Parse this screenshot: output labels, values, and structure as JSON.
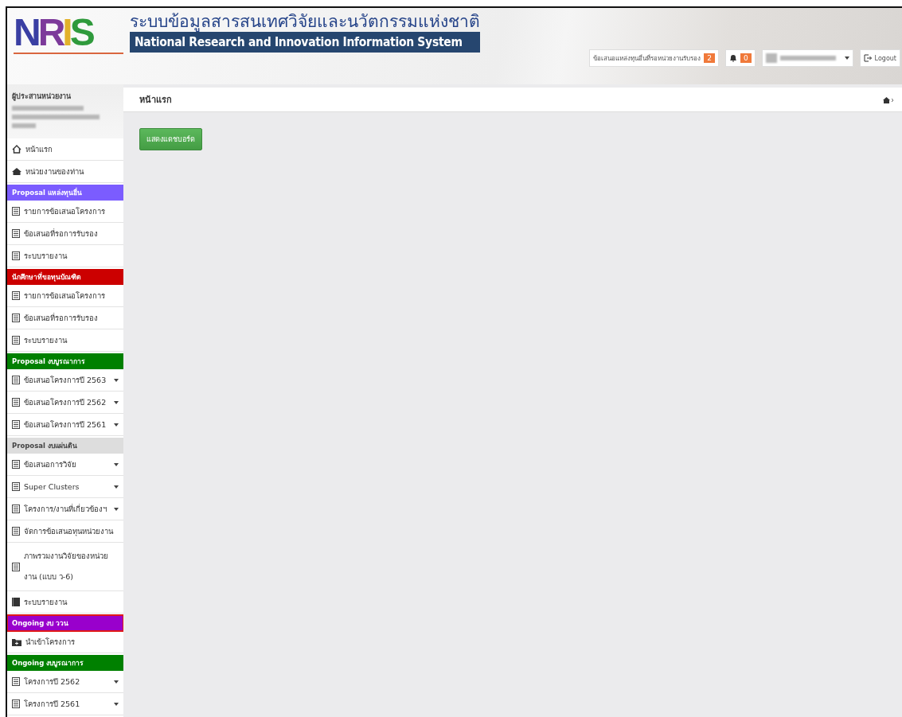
{
  "header": {
    "logo": "NRIS",
    "title_th": "ระบบข้อมูลสารสนเทศวิจัยและนวัตกรรมแห่งชาติ",
    "title_en": "National Research and Innovation Information System",
    "pending_button": {
      "label": "ข้อเสนอแหล่งทุนอื่นที่รอหน่วยงานรับรอง",
      "badge": "2"
    },
    "alerts_badge": "0",
    "logout": "Logout"
  },
  "sidebar": {
    "role": "ผู้ประสานหน่วยงาน",
    "items": [
      {
        "kind": "home",
        "label": "หน้าแรก",
        "expandable": false
      },
      {
        "kind": "unit",
        "label": "หน่วยงานของท่าน",
        "expandable": false
      },
      {
        "kind": "header",
        "label": "Proposal แหล่งทุนอื่น",
        "color": "#7b5cff",
        "highlighted": false
      },
      {
        "kind": "link",
        "label": "รายการข้อเสนอโครงการ",
        "expandable": false
      },
      {
        "kind": "link",
        "label": "ข้อเสนอที่รอการรับรอง",
        "expandable": false
      },
      {
        "kind": "link",
        "label": "ระบบรายงาน",
        "expandable": false
      },
      {
        "kind": "header",
        "label": "นักศึกษาที่ขอทุนบัณฑิต",
        "color": "#cc0000",
        "highlighted": false
      },
      {
        "kind": "link",
        "label": "รายการข้อเสนอโครงการ",
        "expandable": false
      },
      {
        "kind": "link",
        "label": "ข้อเสนอที่รอการรับรอง",
        "expandable": false
      },
      {
        "kind": "link",
        "label": "ระบบรายงาน",
        "expandable": false
      },
      {
        "kind": "header",
        "label": "Proposal งบบูรณาการ",
        "color": "#008000",
        "highlighted": false
      },
      {
        "kind": "link",
        "label": "ข้อเสนอโครงการปี 2563",
        "expandable": true
      },
      {
        "kind": "link",
        "label": "ข้อเสนอโครงการปี 2562",
        "expandable": true
      },
      {
        "kind": "link",
        "label": "ข้อเสนอโครงการปี 2561",
        "expandable": true
      },
      {
        "kind": "header",
        "label": "Proposal งบแผ่นดิน",
        "color": "#dddddd",
        "highlighted": false
      },
      {
        "kind": "link",
        "label": "ข้อเสนอการวิจัย",
        "expandable": true
      },
      {
        "kind": "link",
        "label": "Super Clusters",
        "expandable": true
      },
      {
        "kind": "link",
        "label": "โครงการ/งานที่เกี่ยวข้องฯ",
        "expandable": true
      },
      {
        "kind": "link",
        "label": "จัดการข้อเสนอทุนหน่วยงาน",
        "expandable": false
      },
      {
        "kind": "link",
        "label": "ภาพรวมงานวิจัยของหน่วยงาน (แบบ ว-6)",
        "expandable": false
      },
      {
        "kind": "book",
        "label": "ระบบรายงาน",
        "expandable": false
      },
      {
        "kind": "header",
        "label": "Ongoing งบ ววน",
        "color": "#9900cc",
        "highlighted": true
      },
      {
        "kind": "folder",
        "label": "นำเข้าโครงการ",
        "expandable": false
      },
      {
        "kind": "header",
        "label": "Ongoing งบบูรณาการ",
        "color": "#008000",
        "highlighted": false
      },
      {
        "kind": "link",
        "label": "โครงการปี 2562",
        "expandable": true
      },
      {
        "kind": "link",
        "label": "โครงการปี 2561",
        "expandable": true
      }
    ]
  },
  "main": {
    "breadcrumb": "หน้าแรก",
    "dashboard_button": "แสดงแดชบอร์ด"
  }
}
